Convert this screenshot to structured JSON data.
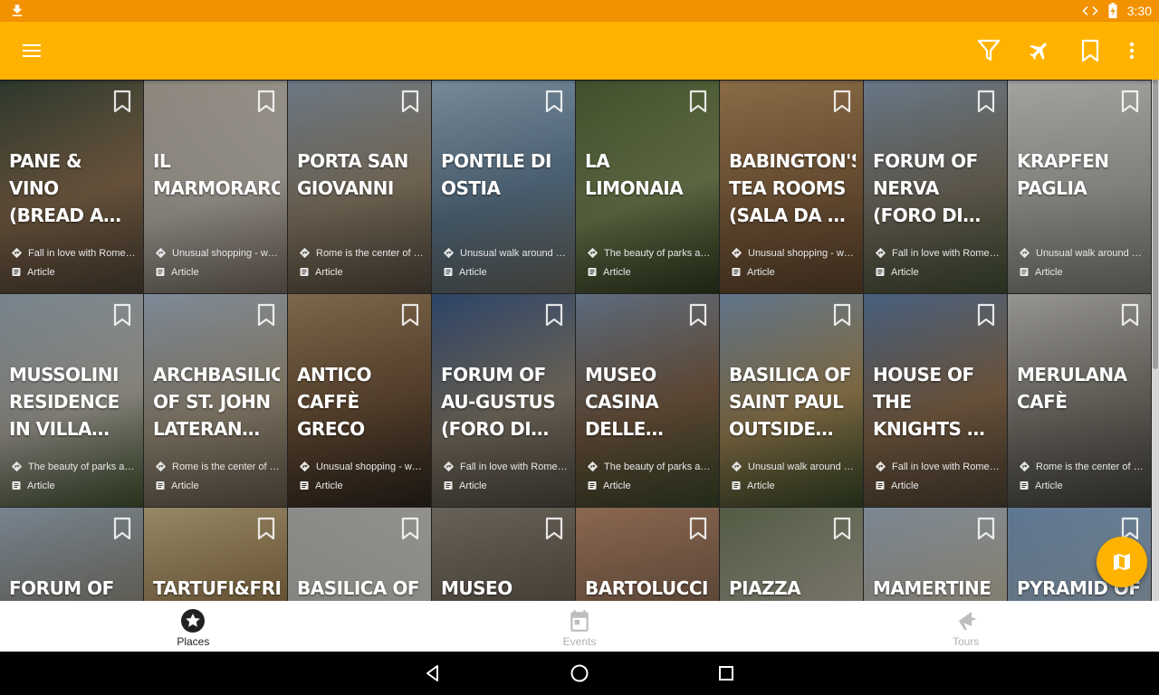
{
  "status_bar": {
    "time": "3:30"
  },
  "toolbar": {
    "icons": [
      "menu-icon",
      "filter-icon",
      "flight-icon",
      "bookmark-icon",
      "more-vert-icon"
    ]
  },
  "tiles": [
    {
      "title": "PANE & VINO (BREAD AND WINE)",
      "category": "Fall in love with Rome …",
      "type": "Article",
      "colors": [
        "#3b4a3a",
        "#9a7b5a",
        "#6a5a46"
      ]
    },
    {
      "title": "IL MARMORARO",
      "category": "Unusual shopping - wh…",
      "type": "Article",
      "colors": [
        "#bcb4a8",
        "#d9d2c7",
        "#9d8f80"
      ]
    },
    {
      "title": "PORTA SAN GIOVANNI",
      "category": "Rome is the center of …",
      "type": "Article",
      "colors": [
        "#8fa0b1",
        "#a6957b",
        "#6e6251"
      ]
    },
    {
      "title": "PONTILE DI OSTIA",
      "category": "Unusual walk around R…",
      "type": "Article",
      "colors": [
        "#9fb8cc",
        "#6e8ea8",
        "#8b8b7f"
      ]
    },
    {
      "title": "LA LIMONAIA",
      "category": "The beauty of parks an…",
      "type": "Article",
      "colors": [
        "#556b3a",
        "#8b9a63",
        "#3f4f2a"
      ]
    },
    {
      "title": "BABINGTON'S TEA ROOMS (SALA DA TÈ B…",
      "category": "Unusual shopping - wh…",
      "type": "Article",
      "colors": [
        "#b88f5d",
        "#9a7249",
        "#7d5c3e"
      ]
    },
    {
      "title": "FORUM OF NERVA (FORO DI NERVA)",
      "category": "Fall in love with Rome …",
      "type": "Article",
      "colors": [
        "#8aa0b5",
        "#8b8270",
        "#5a6a45"
      ]
    },
    {
      "title": "KRAPFEN PAGLIA",
      "category": "Unusual walk around R…",
      "type": "Article",
      "colors": [
        "#d8d8d4",
        "#c4c4bf",
        "#a9a9a2"
      ]
    },
    {
      "title": "MUSSOLINI RESIDENCE IN VILLA TORLONI…",
      "category": "The beauty of parks an…",
      "type": "Article",
      "colors": [
        "#9fb0bd",
        "#c7c3b7",
        "#5a7040"
      ]
    },
    {
      "title": "ARCHBASILICA OF ST. JOHN LATERAN (BASI…",
      "category": "Rome is the center of …",
      "type": "Article",
      "colors": [
        "#a6b7c9",
        "#b9ab93",
        "#8a7a63"
      ]
    },
    {
      "title": "ANTICO CAFFÈ GRECO",
      "category": "Unusual shopping - wh…",
      "type": "Article",
      "colors": [
        "#a78a64",
        "#7b5d40",
        "#3e3126"
      ]
    },
    {
      "title": "FORUM OF AU-GUSTUS (FORO DI AUGUSTO)",
      "category": "Fall in love with Rome …",
      "type": "Article",
      "colors": [
        "#3a5a8a",
        "#9a8f7d",
        "#6e6555"
      ]
    },
    {
      "title": "MUSEO CASINA DELLE CIVETTE",
      "category": "The beauty of parks an…",
      "type": "Article",
      "colors": [
        "#7a8fa8",
        "#8a6a4d",
        "#4f5e36"
      ]
    },
    {
      "title": "BASILICA OF SAINT PAUL OUTSIDE THE …",
      "category": "Unusual walk around R…",
      "type": "Article",
      "colors": [
        "#7f9bb8",
        "#b89a62",
        "#4b6136"
      ]
    },
    {
      "title": "HOUSE OF THE KNIGHTS OF RHODES (CAS…",
      "category": "Fall in love with Rome …",
      "type": "Article",
      "colors": [
        "#5e7fa8",
        "#9b7a58",
        "#6b5a45"
      ]
    },
    {
      "title": "MERULANA CAFÈ",
      "category": "Rome is the center of …",
      "type": "Article",
      "colors": [
        "#c9c7c2",
        "#8e8a80",
        "#5e5a52"
      ]
    },
    {
      "title": "FORUM OF",
      "category": "",
      "type": "",
      "colors": [
        "#9fb0c0",
        "#8d8a7e",
        "#6e7a55"
      ]
    },
    {
      "title": "TARTUFI&FRIEN",
      "category": "",
      "type": "",
      "colors": [
        "#c9b58a",
        "#9a7c4d",
        "#6e5a3a"
      ]
    },
    {
      "title": "BASILICA OF",
      "category": "",
      "type": "",
      "colors": [
        "#b9b9b5",
        "#d2cfc8",
        "#a8a49b"
      ]
    },
    {
      "title": "MUSEO CAPITO-",
      "category": "",
      "type": "",
      "colors": [
        "#8a8376",
        "#6a5f50",
        "#4a4036"
      ]
    },
    {
      "title": "BARTOLUCCI",
      "category": "",
      "type": "",
      "colors": [
        "#b98a6b",
        "#8c6a54",
        "#6a4e3e"
      ]
    },
    {
      "title": "PIAZZA MARTIN",
      "category": "",
      "type": "",
      "colors": [
        "#6e7a5a",
        "#b3ae9e",
        "#8a8575"
      ]
    },
    {
      "title": "MAMERTINE",
      "category": "",
      "type": "",
      "colors": [
        "#a4b4c4",
        "#c5bda8",
        "#8f8470"
      ]
    },
    {
      "title": "PYRAMID OF",
      "category": "",
      "type": "",
      "colors": [
        "#7d9ec2",
        "#a3b7c8",
        "#8a8a7a"
      ]
    }
  ],
  "bottom_nav": {
    "items": [
      {
        "label": "Places",
        "icon": "star-circle-icon",
        "active": true
      },
      {
        "label": "Events",
        "icon": "calendar-icon",
        "active": false
      },
      {
        "label": "Tours",
        "icon": "tour-flag-icon",
        "active": false
      }
    ]
  },
  "fab": {
    "icon": "map-icon"
  },
  "theme": {
    "status_bar": "#f39200",
    "toolbar": "#ffb300",
    "accent": "#ffb300"
  }
}
